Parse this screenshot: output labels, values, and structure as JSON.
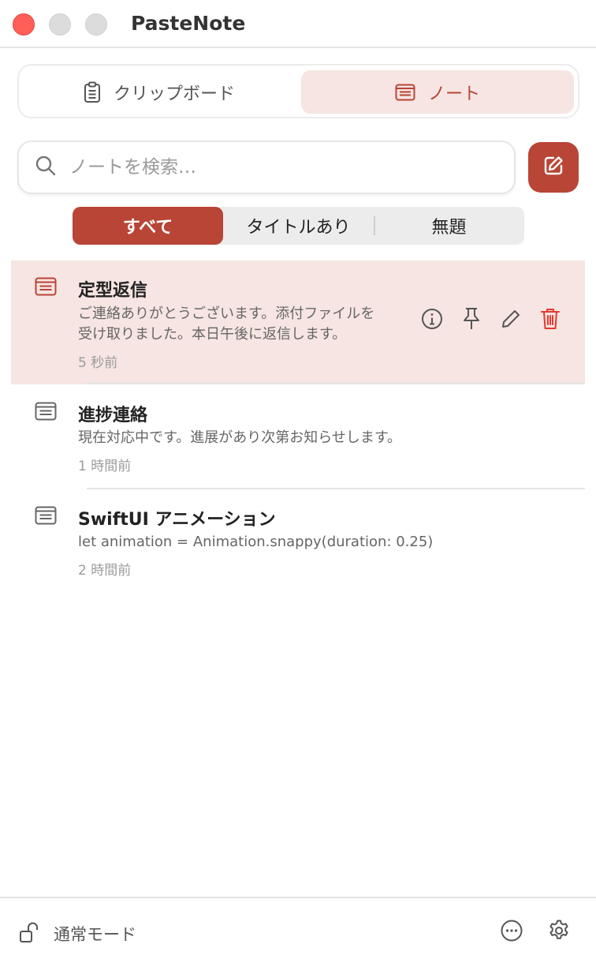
{
  "window": {
    "title": "PasteNote"
  },
  "mode_switch": {
    "tabs": [
      {
        "label": "クリップボード",
        "icon": "clipboard-icon",
        "selected": false
      },
      {
        "label": "ノート",
        "icon": "note-icon",
        "selected": true
      }
    ]
  },
  "search": {
    "placeholder": "ノートを検索…",
    "value": ""
  },
  "filter": {
    "segments": [
      {
        "label": "すべて",
        "selected": true
      },
      {
        "label": "タイトルあり",
        "selected": false
      },
      {
        "label": "無題",
        "selected": false
      }
    ]
  },
  "notes": [
    {
      "title": "定型返信",
      "body": [
        "ご連絡ありがとうございます。添付ファイルを",
        "受け取りました。本日午後に返信します。"
      ],
      "time": "5 秒前",
      "selected": true
    },
    {
      "title": "進捗連絡",
      "body": [
        "現在対応中です。進展があり次第お知らせします。"
      ],
      "time": "1 時間前",
      "selected": false
    },
    {
      "title": "SwiftUI アニメーション",
      "body": [
        "let animation = Animation.snappy(duration: 0.25)"
      ],
      "time": "2 時間前",
      "selected": false
    }
  ],
  "footer": {
    "mode_label": "通常モード"
  },
  "colors": {
    "accent": "#b84536",
    "accent_light": "#f6e5e2",
    "close": "#ff5f57",
    "delete": "#e5392e"
  }
}
